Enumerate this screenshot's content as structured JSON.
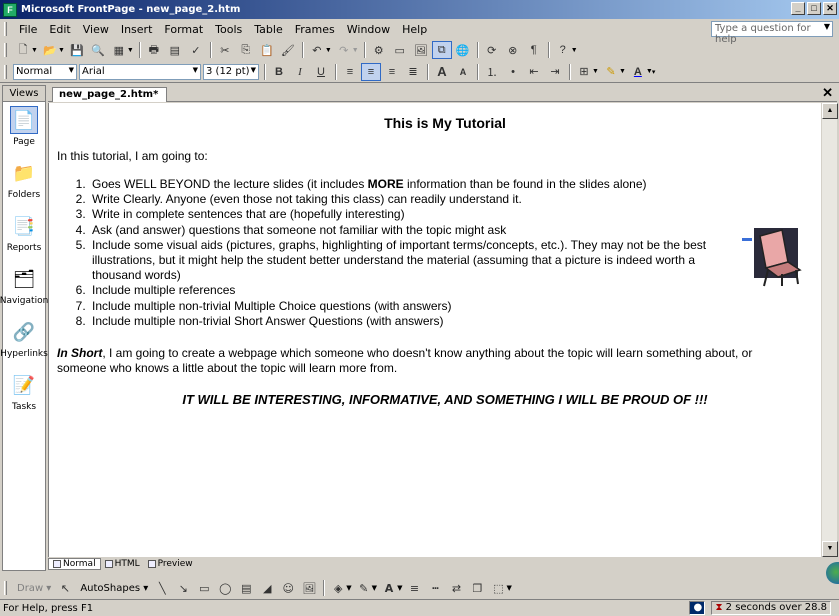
{
  "window": {
    "title": "Microsoft FrontPage - new_page_2.htm",
    "app_icon": "frontpage-icon"
  },
  "menu": {
    "items": [
      "File",
      "Edit",
      "View",
      "Insert",
      "Format",
      "Tools",
      "Table",
      "Frames",
      "Window",
      "Help"
    ],
    "help_placeholder": "Type a question for help"
  },
  "format_toolbar": {
    "style": "Normal",
    "font": "Arial",
    "size": "3 (12 pt)"
  },
  "views_panel": {
    "header": "Views",
    "items": [
      "Page",
      "Folders",
      "Reports",
      "Navigation",
      "Hyperlinks",
      "Tasks"
    ]
  },
  "document": {
    "tab": "new_page_2.htm*",
    "title": "This is My Tutorial",
    "intro": "In this tutorial, I am going to:",
    "items": [
      {
        "pre": "Goes WELL BEYOND the  lecture slides (it includes ",
        "bold": "MORE",
        "post": " information than be found in the slides alone)"
      },
      {
        "text": "Write Clearly. Anyone (even those not taking this class) can readily understand it."
      },
      {
        "text": "Write in complete sentences that are (hopefully interesting)"
      },
      {
        "text": "Ask (and answer) questions that someone not familiar with the topic might ask"
      },
      {
        "text": "Include some visual aids (pictures, graphs, highlighting of important terms/concepts, etc.). They may not be the best illustrations, but it might help the student better understand the material (assuming that a picture is indeed worth a thousand words)"
      },
      {
        "text": "Include multiple references"
      },
      {
        "text": "Include multiple non-trivial Multiple Choice questions (with answers)"
      },
      {
        "text": "Include multiple non-trivial Short Answer Questions (with answers)"
      }
    ],
    "summary_lead": "In Short",
    "summary_rest": ", I am going to create a webpage which someone who doesn't know anything about the topic will learn something about, or someone who knows a little about the topic will learn more from.",
    "shout": "IT WILL BE INTERESTING, INFORMATIVE, AND SOMETHING I WILL BE PROUD OF !!!"
  },
  "view_tabs": [
    "Normal",
    "HTML",
    "Preview"
  ],
  "draw_toolbar": {
    "draw": "Draw",
    "autoshapes": "AutoShapes"
  },
  "status": {
    "left": "For Help, press F1",
    "right": "2 seconds over 28.8"
  }
}
